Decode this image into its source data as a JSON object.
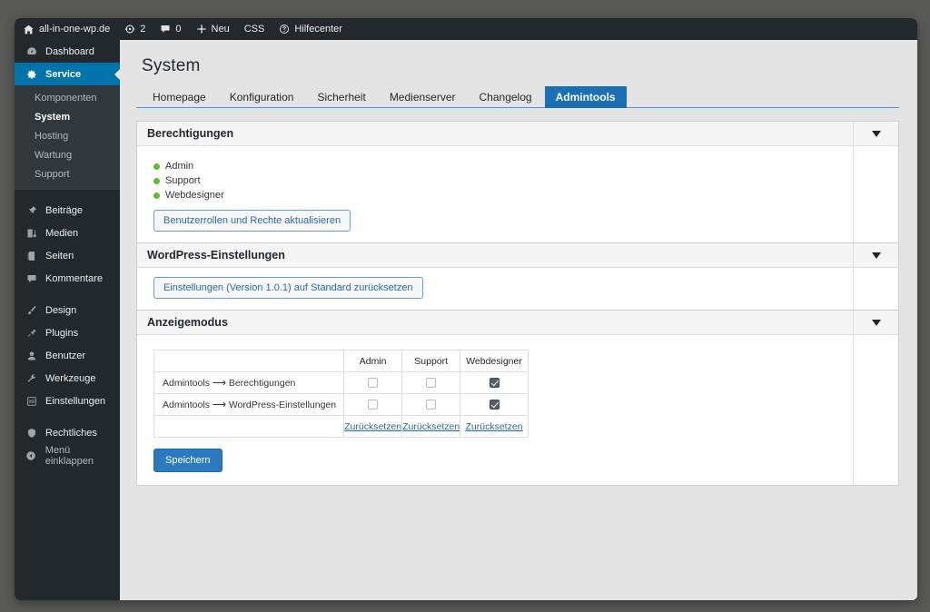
{
  "adminbar": {
    "site_name": "all-in-one-wp.de",
    "updates_count": "2",
    "comments_count": "0",
    "new_label": "Neu",
    "css_label": "CSS",
    "help_label": "Hilfecenter"
  },
  "sidebar": {
    "items": [
      {
        "label": "Dashboard",
        "icon": "dashboard-icon"
      },
      {
        "label": "Service",
        "icon": "gear-icon"
      },
      {
        "label": "Beiträge",
        "icon": "pin-icon"
      },
      {
        "label": "Medien",
        "icon": "media-icon"
      },
      {
        "label": "Seiten",
        "icon": "pages-icon"
      },
      {
        "label": "Kommentare",
        "icon": "comment-icon"
      },
      {
        "label": "Design",
        "icon": "brush-icon"
      },
      {
        "label": "Plugins",
        "icon": "plug-icon"
      },
      {
        "label": "Benutzer",
        "icon": "user-icon"
      },
      {
        "label": "Werkzeuge",
        "icon": "wrench-icon"
      },
      {
        "label": "Einstellungen",
        "icon": "sliders-icon"
      },
      {
        "label": "Rechtliches",
        "icon": "shield-icon"
      },
      {
        "label": "Menü einklappen",
        "icon": "collapse-icon"
      }
    ],
    "submenu": [
      {
        "label": "Komponenten"
      },
      {
        "label": "System"
      },
      {
        "label": "Hosting"
      },
      {
        "label": "Wartung"
      },
      {
        "label": "Support"
      }
    ]
  },
  "page": {
    "title": "System",
    "tabs": [
      {
        "label": "Homepage"
      },
      {
        "label": "Konfiguration"
      },
      {
        "label": "Sicherheit"
      },
      {
        "label": "Medienserver"
      },
      {
        "label": "Changelog"
      },
      {
        "label": "Admintools"
      }
    ]
  },
  "panels": {
    "permissions": {
      "title": "Berechtigungen",
      "roles": [
        {
          "label": "Admin"
        },
        {
          "label": "Support"
        },
        {
          "label": "Webdesigner"
        }
      ],
      "button": "Benutzerrollen und Rechte aktualisieren"
    },
    "wp_settings": {
      "title": "WordPress-Einstellungen",
      "button": "Einstellungen (Version 1.0.1) auf Standard zurücksetzen"
    },
    "display_mode": {
      "title": "Anzeigemodus",
      "columns": [
        "",
        "Admin",
        "Support",
        "Webdesigner"
      ],
      "rows": [
        {
          "label": "Admintools ⟶ Berechtigungen",
          "admin": false,
          "support": false,
          "webdesigner": true
        },
        {
          "label": "Admintools ⟶ WordPress-Einstellungen",
          "admin": false,
          "support": false,
          "webdesigner": true
        }
      ],
      "reset_label": "Zurücksetzen",
      "save_label": "Speichern"
    }
  },
  "colors": {
    "accent": "#0073aa",
    "tab_active": "#1a6fb5",
    "primary_button": "#2b7ac0",
    "status_green": "#5bbf2f",
    "sidebar_bg": "#23282d"
  }
}
